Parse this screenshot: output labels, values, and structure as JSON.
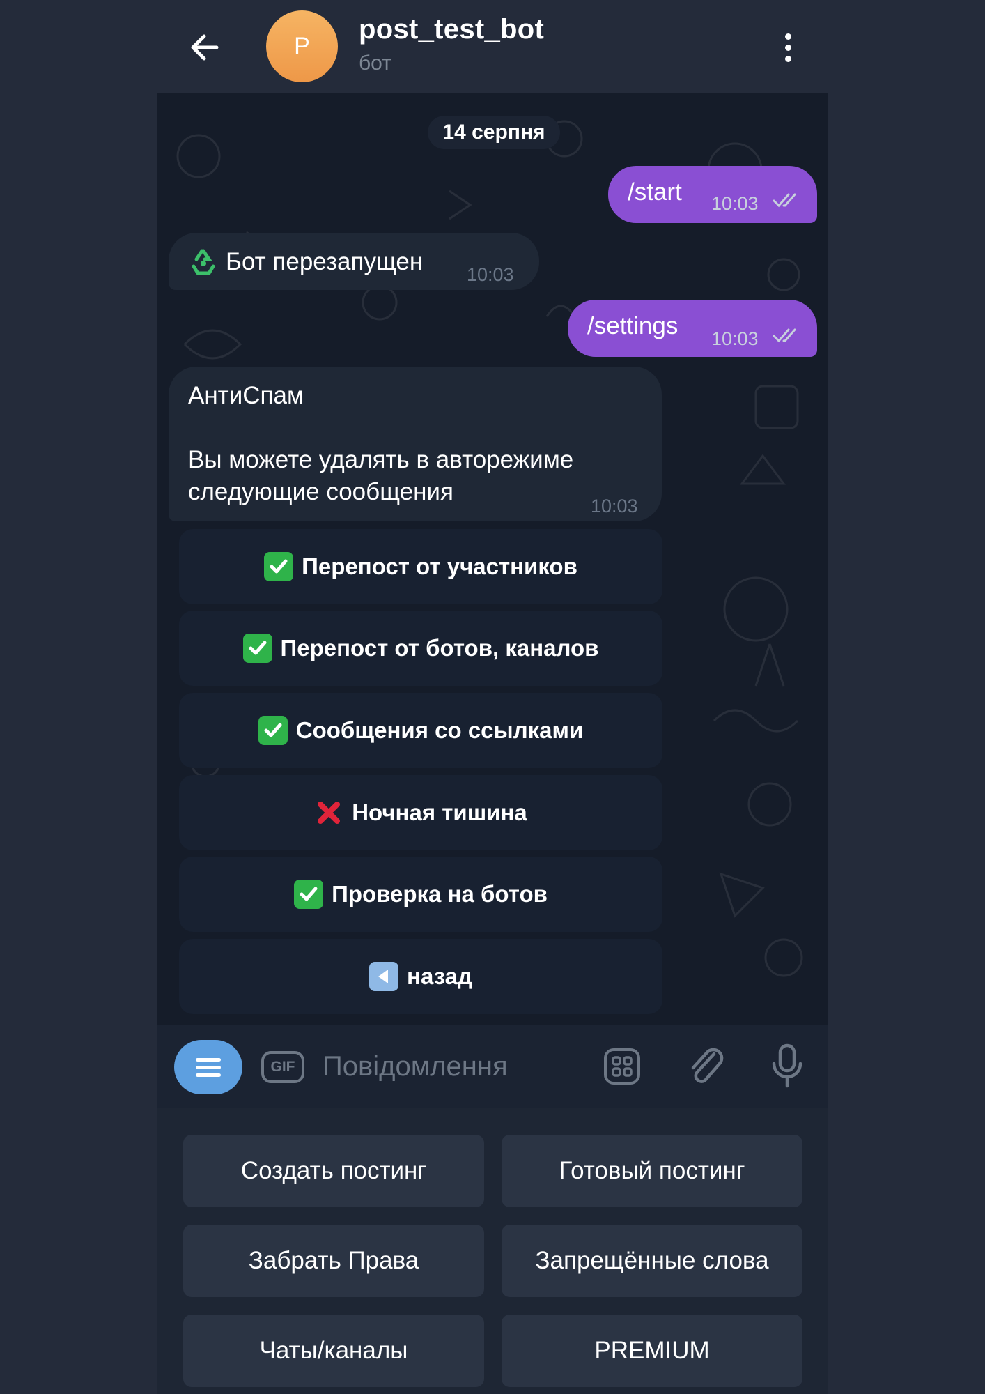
{
  "header": {
    "avatar_letter": "P",
    "title": "post_test_bot",
    "subtitle": "бот",
    "back_icon": "arrow-left-icon",
    "menu_icon": "more-vertical-icon"
  },
  "chat": {
    "date": "14 серпня",
    "messages": [
      {
        "direction": "out",
        "text": "/start",
        "time": "10:03",
        "status": "read"
      },
      {
        "direction": "in",
        "emoji": "recycle-icon",
        "text": "Бот перезапущен",
        "time": "10:03"
      },
      {
        "direction": "out",
        "text": "/settings",
        "time": "10:03",
        "status": "read"
      },
      {
        "direction": "in",
        "title": "АнтиСпам",
        "text_line1": "Вы можете удалять в авторежиме",
        "text_line2": "следующие сообщения",
        "time": "10:03"
      }
    ],
    "inline_keyboard": [
      {
        "icon": "check-mark-icon",
        "label": "Перепост от участников"
      },
      {
        "icon": "check-mark-icon",
        "label": "Перепост от ботов, каналов"
      },
      {
        "icon": "check-mark-icon",
        "label": "Сообщения со ссылками"
      },
      {
        "icon": "cross-mark-icon",
        "label": "Ночная тишина"
      },
      {
        "icon": "check-mark-icon",
        "label": "Проверка на ботов"
      },
      {
        "icon": "back-arrow-icon",
        "label": "назад"
      }
    ]
  },
  "input": {
    "gif_label": "GIF",
    "placeholder": "Повідомлення"
  },
  "reply_keyboard": [
    [
      "Создать постинг",
      "Готовый постинг"
    ],
    [
      "Забрать Права",
      "Запрещённые слова"
    ],
    [
      "Чаты/каналы",
      "PREMIUM"
    ]
  ],
  "colors": {
    "outgoing_bubble": "#8a4fd3",
    "incoming_bubble": "#1f2836",
    "chat_background": "#151c29",
    "menu_button": "#5d9fe0",
    "avatar": "#ee9848",
    "check_green": "#2fb34a",
    "cross_red": "#e0243a"
  }
}
